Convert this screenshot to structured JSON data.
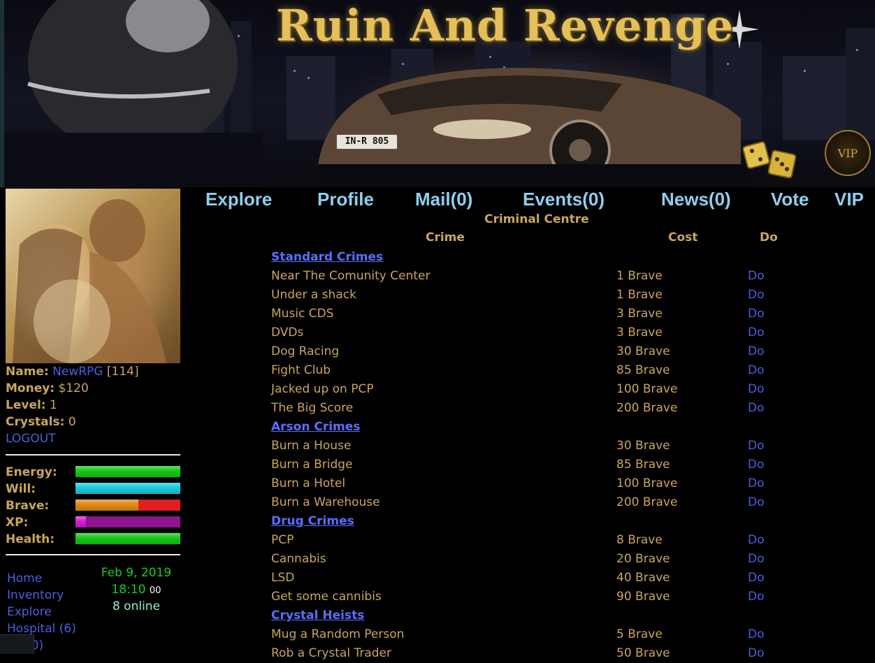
{
  "banner": {
    "title": "Ruin And Revenge",
    "plate": "IN-R 805",
    "vip_label": "VIP"
  },
  "player": {
    "name_label": "Name:",
    "name": "NewRPG",
    "id": "[114]",
    "money_label": "Money:",
    "money": "$120",
    "level_label": "Level:",
    "level": "1",
    "crystals_label": "Crystals:",
    "crystals": "0",
    "logout": "LOGOUT"
  },
  "bars": {
    "energy": {
      "label": "Energy:",
      "fraction": 1.0,
      "color": "#14c814"
    },
    "will": {
      "label": "Will:",
      "fraction": 1.0,
      "color": "#1ec8e0"
    },
    "brave": {
      "label": "Brave:",
      "fraction": 0.6,
      "color": "#e08a14",
      "empty_color": "#e01e1e"
    },
    "xp": {
      "label": "XP:",
      "fraction": 0.1,
      "color": "#d21ed2",
      "empty_color": "#8c148c"
    },
    "health": {
      "label": "Health:",
      "fraction": 1.0,
      "color": "#14c814"
    }
  },
  "sidebar_nav": [
    "Home",
    "Inventory",
    "Explore",
    "Hospital (6)",
    "(0)"
  ],
  "clock": {
    "date": "Feb 9, 2019",
    "time": "18:10",
    "seconds": "00",
    "online": "8 online"
  },
  "top_nav": [
    "Explore",
    "Profile",
    "Mail(0)",
    "Events(0)",
    "News(0)",
    "Vote",
    "VIP"
  ],
  "page": {
    "heading": "Criminal Centre",
    "col_crime": "Crime",
    "col_cost": "Cost",
    "col_do": "Do"
  },
  "crimes": [
    {
      "group": "Standard Crimes"
    },
    {
      "name": "Near The Comunity Center",
      "cost": "1 Brave",
      "do": "Do"
    },
    {
      "name": "Under a shack",
      "cost": "1 Brave",
      "do": "Do"
    },
    {
      "name": "Music CDS",
      "cost": "3 Brave",
      "do": "Do"
    },
    {
      "name": "DVDs",
      "cost": "3 Brave",
      "do": "Do"
    },
    {
      "name": "Dog Racing",
      "cost": "30 Brave",
      "do": "Do"
    },
    {
      "name": "Fight Club",
      "cost": "85 Brave",
      "do": "Do"
    },
    {
      "name": "Jacked up on PCP",
      "cost": "100 Brave",
      "do": "Do"
    },
    {
      "name": "The Big Score",
      "cost": "200 Brave",
      "do": "Do"
    },
    {
      "group": "Arson Crimes"
    },
    {
      "name": "Burn a House",
      "cost": "30 Brave",
      "do": "Do"
    },
    {
      "name": "Burn a Bridge",
      "cost": "85 Brave",
      "do": "Do"
    },
    {
      "name": "Burn a Hotel",
      "cost": "100 Brave",
      "do": "Do"
    },
    {
      "name": "Burn a Warehouse",
      "cost": "200 Brave",
      "do": "Do"
    },
    {
      "group": "Drug Crimes"
    },
    {
      "name": "PCP",
      "cost": "8 Brave",
      "do": "Do"
    },
    {
      "name": "Cannabis",
      "cost": "20 Brave",
      "do": "Do"
    },
    {
      "name": "LSD",
      "cost": "40 Brave",
      "do": "Do"
    },
    {
      "name": "Get some cannibis",
      "cost": "90 Brave",
      "do": "Do"
    },
    {
      "group": "Crystal Heists"
    },
    {
      "name": "Mug a Random Person",
      "cost": "5 Brave",
      "do": "Do"
    },
    {
      "name": "Rob a Crystal Trader",
      "cost": "50 Brave",
      "do": "Do"
    }
  ]
}
